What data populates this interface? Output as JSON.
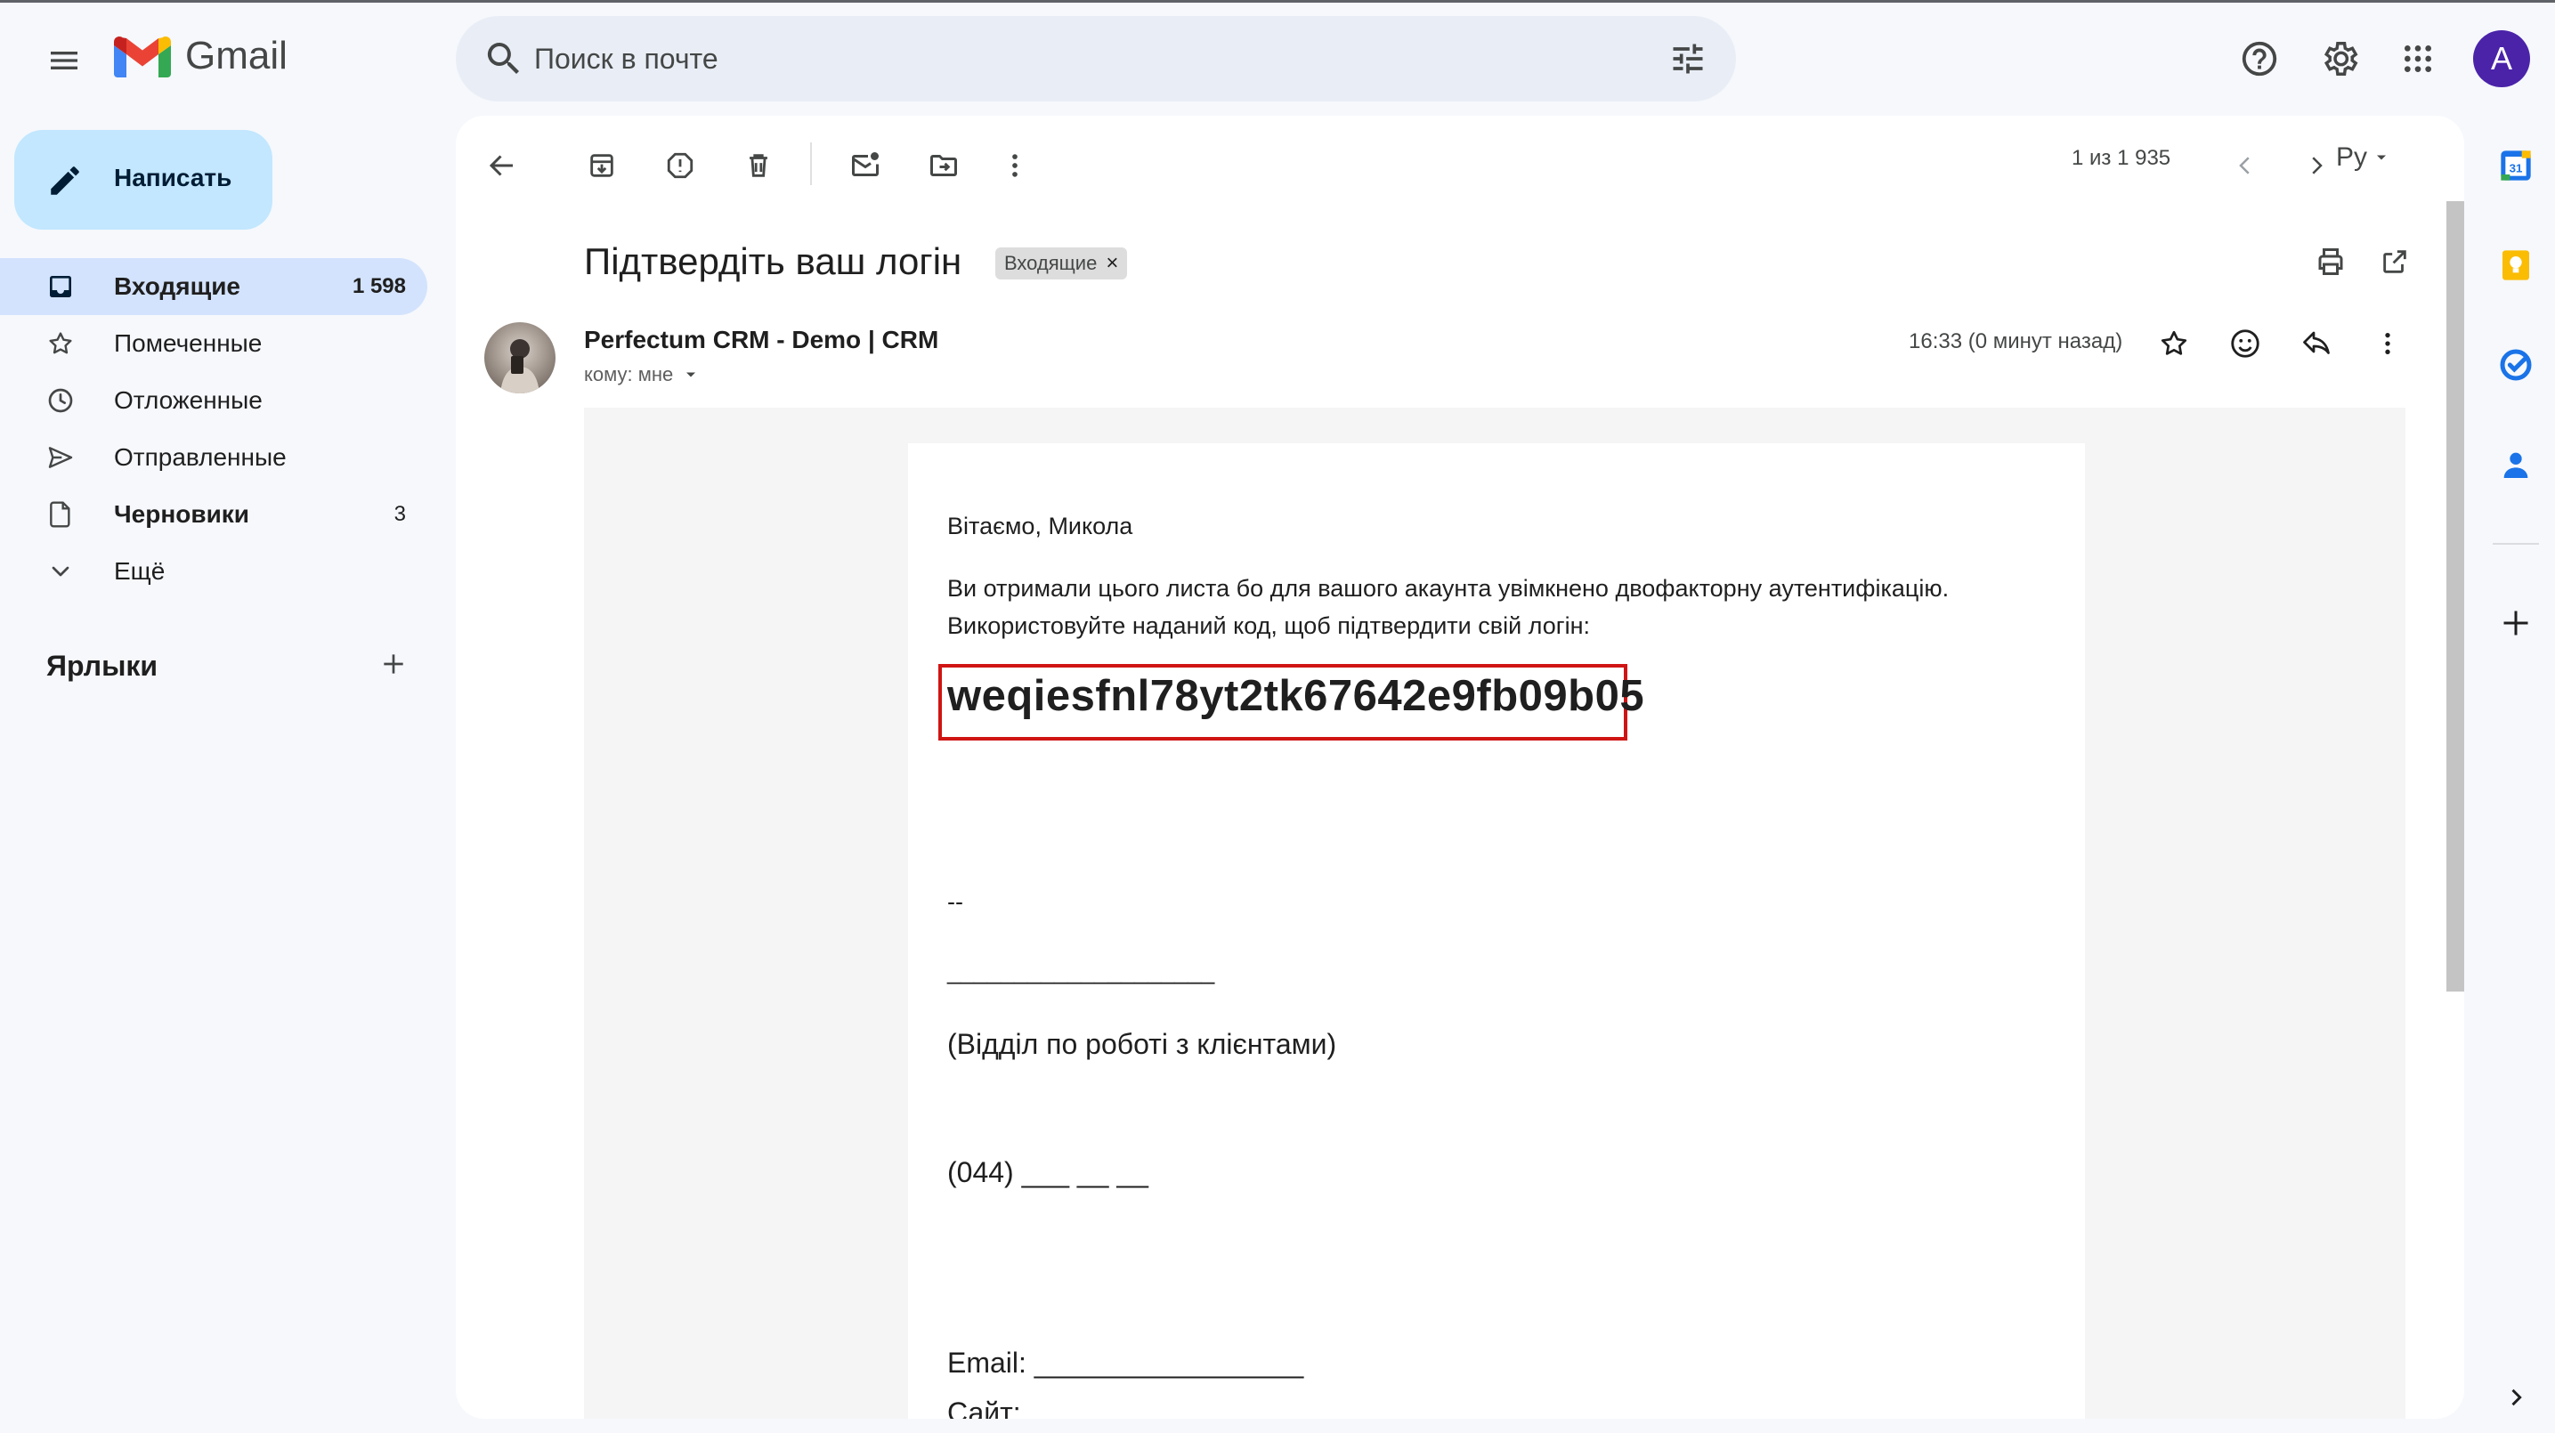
{
  "app": {
    "logo_text": "Gmail",
    "avatar_letter": "A"
  },
  "search": {
    "placeholder": "Поиск в почте"
  },
  "compose": {
    "label": "Написать"
  },
  "sidebar": {
    "items": [
      {
        "label": "Входящие",
        "count": "1 598"
      },
      {
        "label": "Помеченные",
        "count": ""
      },
      {
        "label": "Отложенные",
        "count": ""
      },
      {
        "label": "Отправленные",
        "count": ""
      },
      {
        "label": "Черновики",
        "count": "3"
      },
      {
        "label": "Ещё",
        "count": ""
      }
    ],
    "labels_title": "Ярлыки"
  },
  "toolbar": {
    "pager": "1 из 1 935",
    "lang": "Ру"
  },
  "message": {
    "subject": "Підтвердіть ваш логін",
    "chip": "Входящие",
    "chip_close": "×",
    "sender": "Perfectum CRM - Demo | CRM",
    "recipient": "кому: мне",
    "time": "16:33 (0 минут назад)"
  },
  "email_body": {
    "greeting": "Вітаємо, Микола",
    "line1": "Ви отримали цього листа бо для вашого акаунта увімкнено двофакторну аутентифікацію.",
    "line2": "Використовуйте наданий код, щоб підтвердити свій логін:",
    "code": "weqiesfnl78yt2tk67642e9fb09b05",
    "sig_dash": "--",
    "sig_line": "____________________",
    "department": "(Відділ по роботі з клієнтами)",
    "phone": "(044) ___ __ __",
    "email": "Email: _________________",
    "site": "Сайт:"
  },
  "colors": {
    "accent": "#0b57d0",
    "active_nav": "#d3e3fd",
    "compose": "#c2e7ff",
    "highlight_box": "#d01414",
    "avatar": "#4a23a9"
  },
  "icons": [
    "menu-icon",
    "search-icon",
    "tune-icon",
    "help-icon",
    "gear-icon",
    "apps-icon",
    "pencil-icon",
    "inbox-icon",
    "star-icon",
    "clock-icon",
    "send-icon",
    "draft-icon",
    "chevron-down-icon",
    "plus-icon",
    "back-arrow-icon",
    "archive-icon",
    "report-spam-icon",
    "delete-icon",
    "mark-unread-icon",
    "move-to-icon",
    "more-vert-icon",
    "chevron-left-icon",
    "chevron-right-icon",
    "print-icon",
    "open-new-window-icon",
    "emoji-icon",
    "reply-icon",
    "calendar-icon",
    "keep-icon",
    "tasks-icon",
    "contacts-icon"
  ]
}
